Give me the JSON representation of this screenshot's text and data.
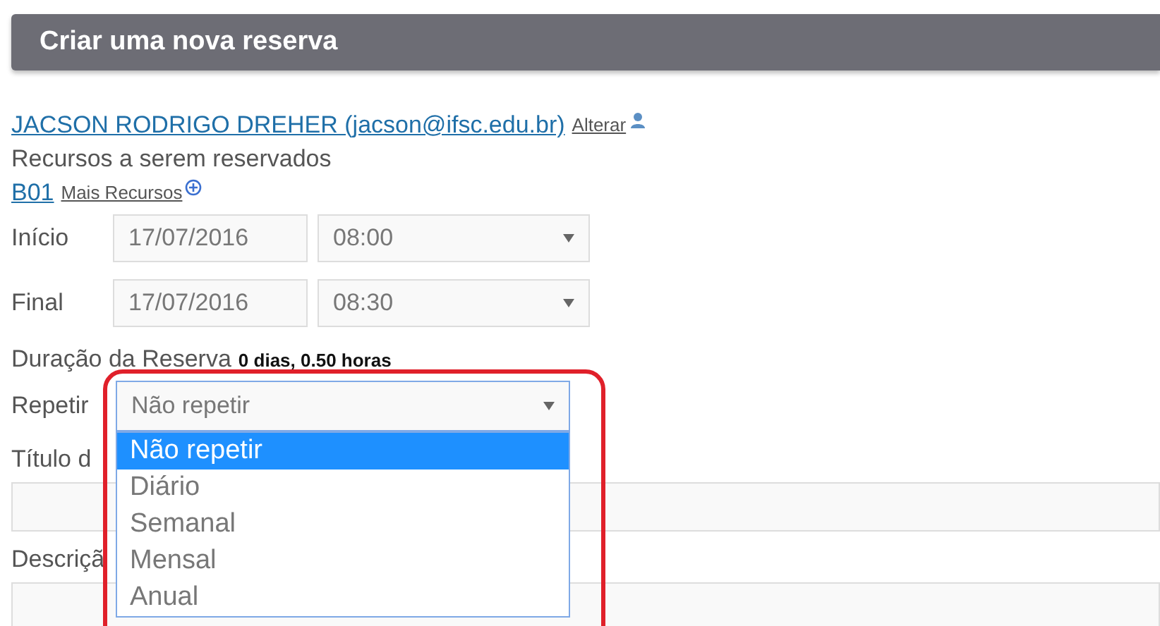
{
  "header": {
    "title": "Criar uma nova reserva"
  },
  "user": {
    "name": "JACSON RODRIGO DREHER (jacson@ifsc.edu.br)",
    "change_link": "Alterar"
  },
  "resources": {
    "label": "Recursos a serem reservados",
    "items": [
      "B01"
    ],
    "more_link": "Mais Recursos"
  },
  "start": {
    "label": "Início",
    "date": "17/07/2016",
    "time": "08:00"
  },
  "end": {
    "label": "Final",
    "date": "17/07/2016",
    "time": "08:30"
  },
  "duration": {
    "label": "Duração da Reserva",
    "value": "0 dias, 0.50 horas"
  },
  "repeat": {
    "label": "Repetir",
    "value": "Não repetir",
    "expanded": true,
    "options": [
      {
        "label": "Não repetir",
        "selected": true
      },
      {
        "label": "Diário",
        "selected": false
      },
      {
        "label": "Semanal",
        "selected": false
      },
      {
        "label": "Mensal",
        "selected": false
      },
      {
        "label": "Anual",
        "selected": false
      }
    ]
  },
  "title_field": {
    "label": "Título d"
  },
  "description_field": {
    "label": "Descriçã"
  }
}
